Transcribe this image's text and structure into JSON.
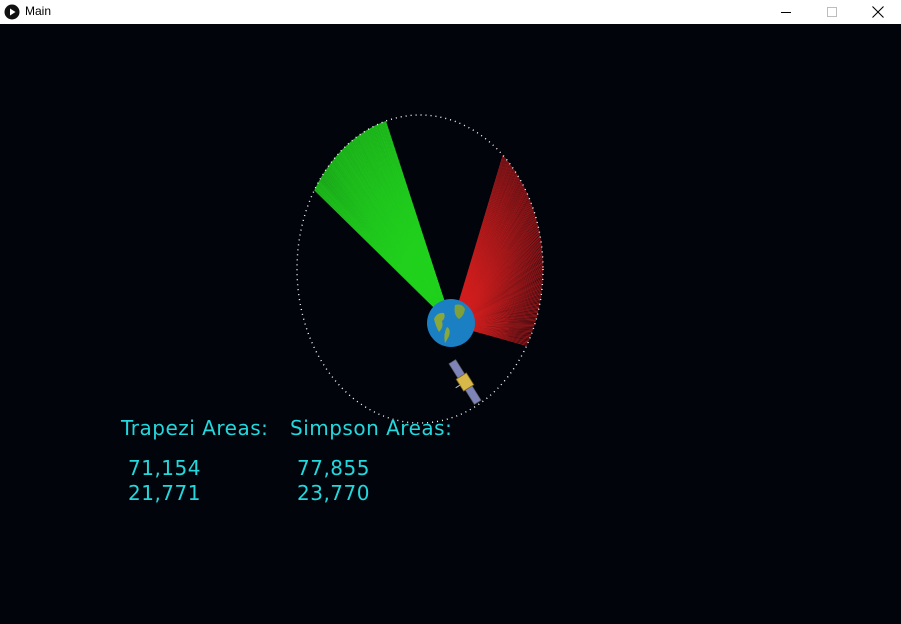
{
  "window": {
    "title": "Main",
    "icons": {
      "app": "play-circle-icon",
      "minimize": "minimize-icon",
      "maximize": "maximize-icon",
      "close": "close-icon"
    }
  },
  "colors": {
    "background": "#02040c",
    "text": "#22d8dc",
    "green_sector": "#22d21e",
    "red_sector": "#d21e1e",
    "orbit_dots": "#ffffff"
  },
  "results": {
    "trapezi": {
      "heading": "Trapezi Areas:",
      "values": [
        "71,154",
        "21,771"
      ]
    },
    "simpson": {
      "heading": "Simpson Areas:",
      "values": [
        "77,855",
        "23,770"
      ]
    }
  }
}
